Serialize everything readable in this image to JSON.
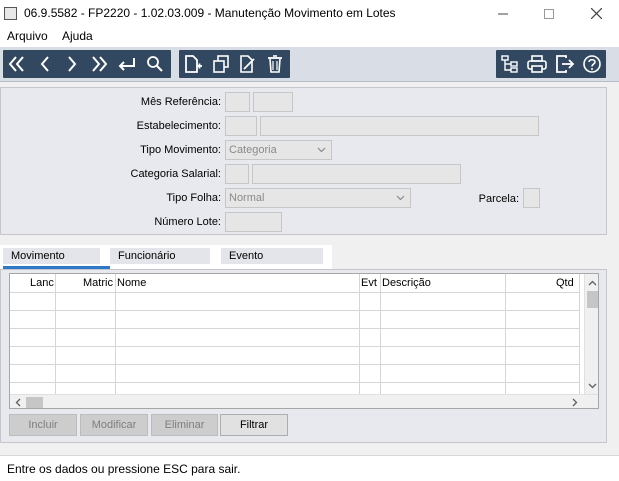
{
  "window": {
    "title": "06.9.5582 - FP2220 - 1.02.03.009 - Manutenção Movimento em Lotes"
  },
  "menu": {
    "items": [
      "Arquivo",
      "Ajuda"
    ]
  },
  "toolbar": {
    "nav_icons": [
      "first-record-icon",
      "previous-record-icon",
      "next-record-icon",
      "last-record-icon",
      "return-icon",
      "search-icon"
    ],
    "doc_icons": [
      "new-document-icon",
      "copy-icon",
      "edit-icon",
      "delete-icon"
    ],
    "system_icons": [
      "tree-icon",
      "print-icon",
      "exit-icon",
      "help-icon"
    ],
    "bar_color": "#324860"
  },
  "form": {
    "mes_referencia": {
      "label": "Mês Referência:",
      "value1": "",
      "value2": ""
    },
    "estabelecimento": {
      "label": "Estabelecimento:",
      "code": "",
      "description": ""
    },
    "tipo_movimento": {
      "label": "Tipo Movimento:",
      "value": "Categoria"
    },
    "categoria_salarial": {
      "label": "Categoria Salarial:",
      "code": "",
      "description": ""
    },
    "tipo_folha": {
      "label": "Tipo Folha:",
      "value": "Normal"
    },
    "parcela": {
      "label": "Parcela:",
      "value": ""
    },
    "numero_lote": {
      "label": "Número Lote:",
      "value": ""
    }
  },
  "tabs": [
    {
      "label": "Movimento",
      "active": true
    },
    {
      "label": "Funcionário",
      "active": false
    },
    {
      "label": "Evento",
      "active": false
    }
  ],
  "grid": {
    "columns": [
      "Lanc",
      "Matric",
      "Nome",
      "Evt",
      "Descrição",
      "Qtd"
    ],
    "rows": []
  },
  "buttons": {
    "incluir": "Incluir",
    "modificar": "Modificar",
    "eliminar": "Eliminar",
    "filtrar": "Filtrar"
  },
  "status": {
    "message": "Entre os dados ou pressione ESC para sair."
  }
}
